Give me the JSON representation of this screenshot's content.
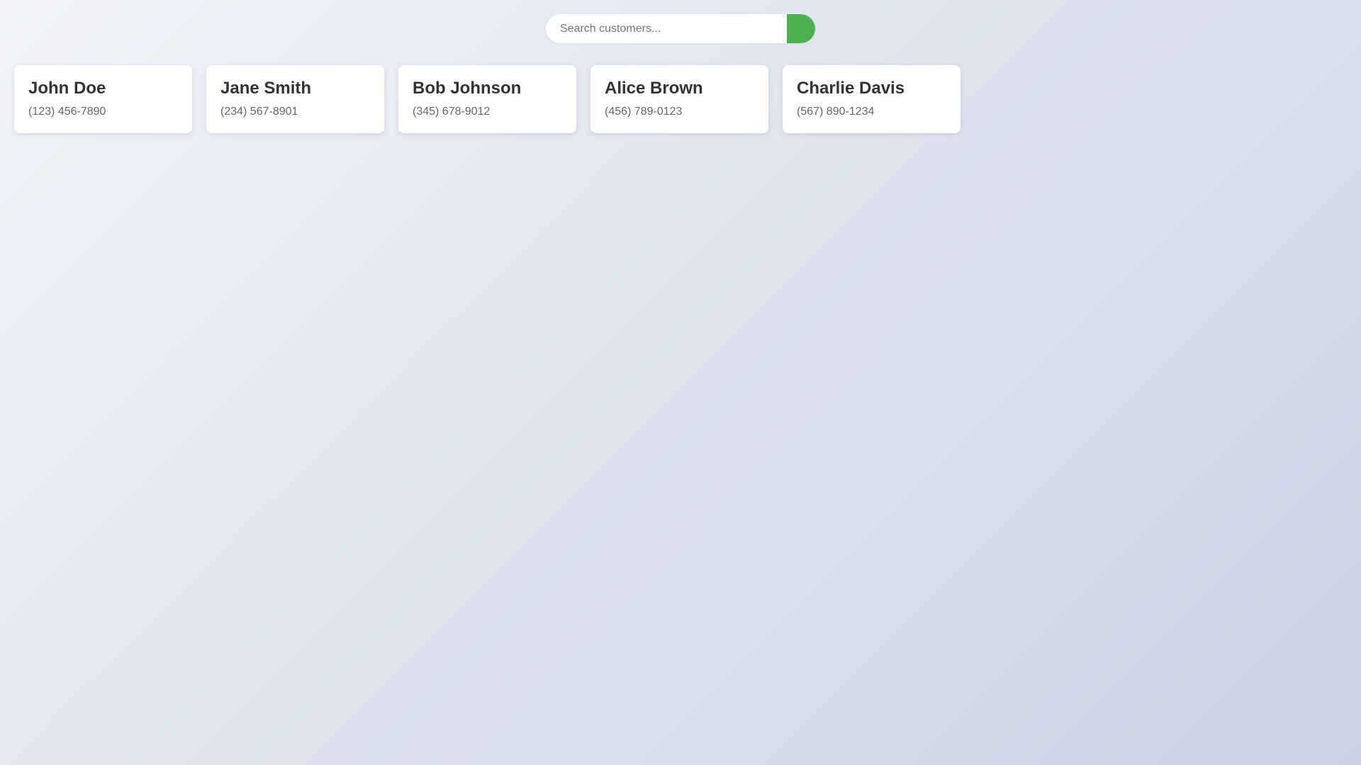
{
  "search": {
    "placeholder": "Search customers...",
    "value": "",
    "button_color": "#4caf50"
  },
  "customers": [
    {
      "name": "John Doe",
      "phone": "(123) 456-7890"
    },
    {
      "name": "Jane Smith",
      "phone": "(234) 567-8901"
    },
    {
      "name": "Bob Johnson",
      "phone": "(345) 678-9012"
    },
    {
      "name": "Alice Brown",
      "phone": "(456) 789-0123"
    },
    {
      "name": "Charlie Davis",
      "phone": "(567) 890-1234"
    }
  ]
}
